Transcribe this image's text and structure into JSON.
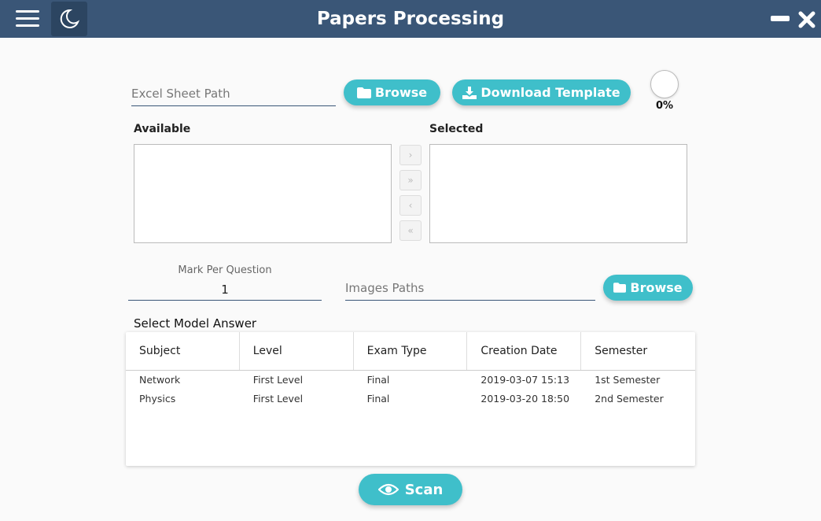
{
  "app": {
    "title": "Papers Processing"
  },
  "excel": {
    "placeholder": "Excel Sheet Path",
    "value": ""
  },
  "buttons": {
    "browse_excel": "Browse",
    "download_template": "Download Template",
    "browse_images": "Browse",
    "scan": "Scan"
  },
  "progress": {
    "value": 0,
    "label": "0%"
  },
  "lists": {
    "available_title": "Available",
    "selected_title": "Selected",
    "move_buttons": [
      "›",
      "»",
      "‹",
      "«"
    ]
  },
  "mark": {
    "label": "Mark Per Question",
    "value": "1"
  },
  "images": {
    "placeholder": "Images Paths",
    "value": ""
  },
  "model_answer": {
    "title": "Select Model Answer",
    "columns": [
      "Subject",
      "Level",
      "Exam Type",
      "Creation Date",
      "Semester"
    ],
    "rows": [
      [
        "Network",
        "First Level",
        "Final",
        "2019-03-07 15:13",
        "1st Semester"
      ],
      [
        "Physics",
        "First Level",
        "Final",
        "2019-03-20 18:50",
        "2nd Semester"
      ]
    ]
  },
  "colors": {
    "titlebar": "#3a5677",
    "accent": "#3fbfca",
    "background": "#fafafa"
  },
  "icons": [
    "hamburger-menu-icon",
    "moon-icon",
    "minimize-icon",
    "close-icon",
    "folder-icon",
    "download-icon",
    "eye-icon"
  ]
}
